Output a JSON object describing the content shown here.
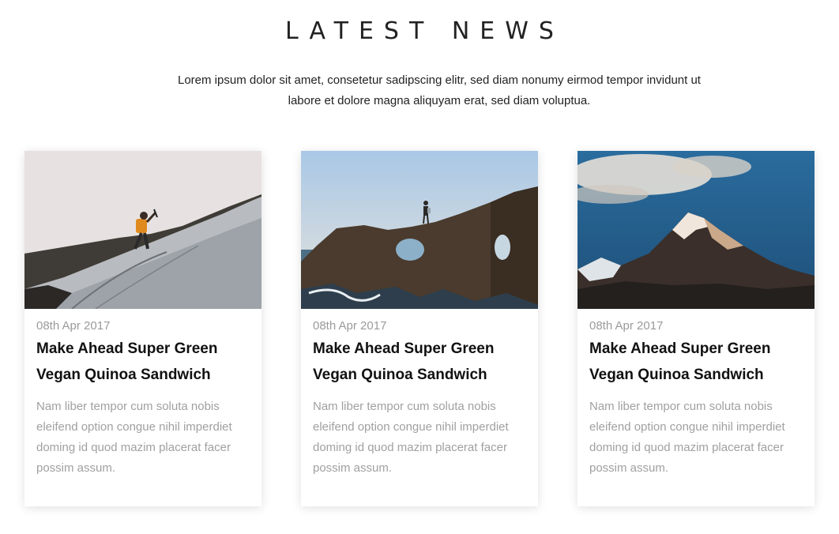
{
  "header": {
    "title": "LATEST NEWS",
    "intro": "Lorem ipsum dolor sit amet, consetetur sadipscing elitr, sed diam nonumy eirmod tempor invidunt ut labore et dolore magna aliquyam erat, sed diam voluptua."
  },
  "posts": [
    {
      "image_icon": "ice-climber-photo",
      "date": "08th Apr 2017",
      "title": "Make Ahead Super Green Vegan Quinoa Sandwich",
      "excerpt": "Nam liber tempor cum soluta nobis eleifend option congue nihil imperdiet doming id quod mazim placerat facer possim assum."
    },
    {
      "image_icon": "rock-arch-hiker-photo",
      "date": "08th Apr 2017",
      "title": "Make Ahead Super Green Vegan Quinoa Sandwich",
      "excerpt": "Nam liber tempor cum soluta nobis eleifend option congue nihil imperdiet doming id quod mazim placerat facer possim assum."
    },
    {
      "image_icon": "mountain-peak-photo",
      "date": "08th Apr 2017",
      "title": "Make Ahead Super Green Vegan Quinoa Sandwich",
      "excerpt": "Nam liber tempor cum soluta nobis eleifend option congue nihil imperdiet doming id quod mazim placerat facer possim assum."
    }
  ]
}
